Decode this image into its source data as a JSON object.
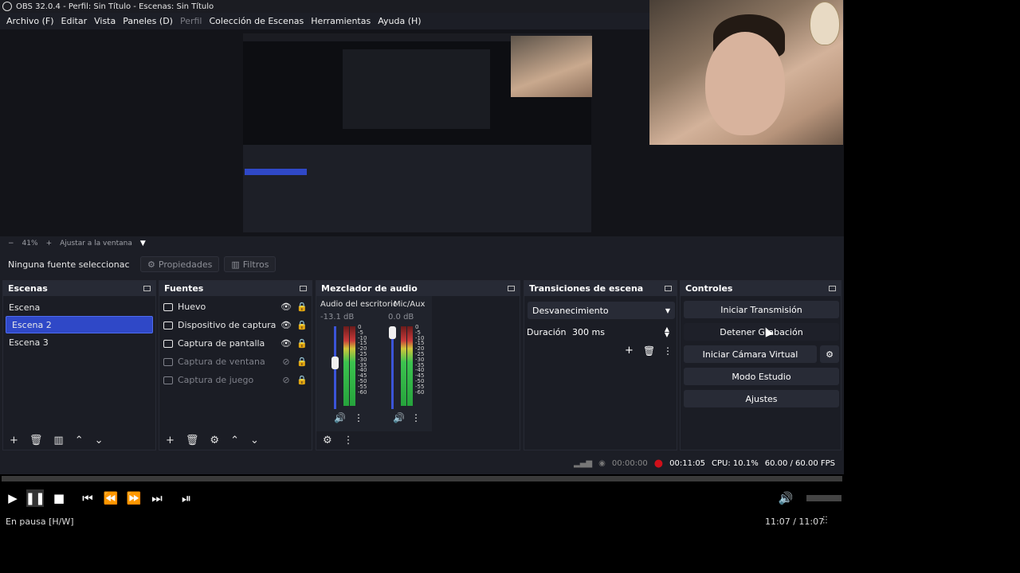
{
  "window": {
    "title": "OBS 32.0.4 - Perfil: Sin Título - Escenas: Sin Título"
  },
  "menu": [
    "Archivo (F)",
    "Editar",
    "Vista",
    "Paneles (D)",
    "Perfil",
    "Colección de Escenas",
    "Herramientas",
    "Ayuda (H)"
  ],
  "zoom": {
    "minus": "−",
    "level": "41%",
    "plus": "+",
    "fit": "Ajustar a la ventana"
  },
  "sourcebar": {
    "status": "Ninguna fuente seleccionac",
    "properties": "Propiedades",
    "filters": "Filtros"
  },
  "scenes": {
    "title": "Escenas",
    "items": [
      "Escena",
      "Escena 2",
      "Escena 3"
    ],
    "selected_index": 1
  },
  "sources": {
    "title": "Fuentes",
    "items": [
      {
        "name": "Huevo",
        "visible": true,
        "locked": false
      },
      {
        "name": "Dispositivo de captura de v",
        "visible": true,
        "locked": false
      },
      {
        "name": "Captura de pantalla",
        "visible": true,
        "locked": false
      },
      {
        "name": "Captura de ventana",
        "visible": false,
        "locked": false
      },
      {
        "name": "Captura de juego",
        "visible": false,
        "locked": true
      }
    ]
  },
  "mixer": {
    "title": "Mezclador de audio",
    "channels": [
      {
        "name": "Audio del escritoric",
        "db": "-13.1 dB",
        "level": 0.58
      },
      {
        "name": "Mic/Aux",
        "db": "0.0 dB",
        "level": 1.0
      }
    ],
    "scale": [
      "0",
      "-5",
      "-10",
      "-15",
      "-20",
      "-25",
      "-30",
      "-35",
      "-40",
      "-45",
      "-50",
      "-55",
      "-60"
    ]
  },
  "transitions": {
    "title": "Transiciones de escena",
    "selected": "Desvanecimiento",
    "duration_label": "Duración",
    "duration_value": "300 ms"
  },
  "controls": {
    "title": "Controles",
    "start_stream": "Iniciar Transmisión",
    "stop_record": "Detener Grabación",
    "start_virtual_cam": "Iniciar Cámara Virtual",
    "studio_mode": "Modo Estudio",
    "settings": "Ajustes"
  },
  "status": {
    "stream_time": "00:00:00",
    "rec_time": "00:11:05",
    "cpu": "CPU: 10.1%",
    "fps": "60.00 / 60.00 FPS"
  },
  "player": {
    "state": "En pausa [H/W]",
    "time": "11:07 / 11:07"
  },
  "colors": {
    "accent": "#2f48c7",
    "rec": "#d0101a",
    "panel": "#1b1d25"
  }
}
